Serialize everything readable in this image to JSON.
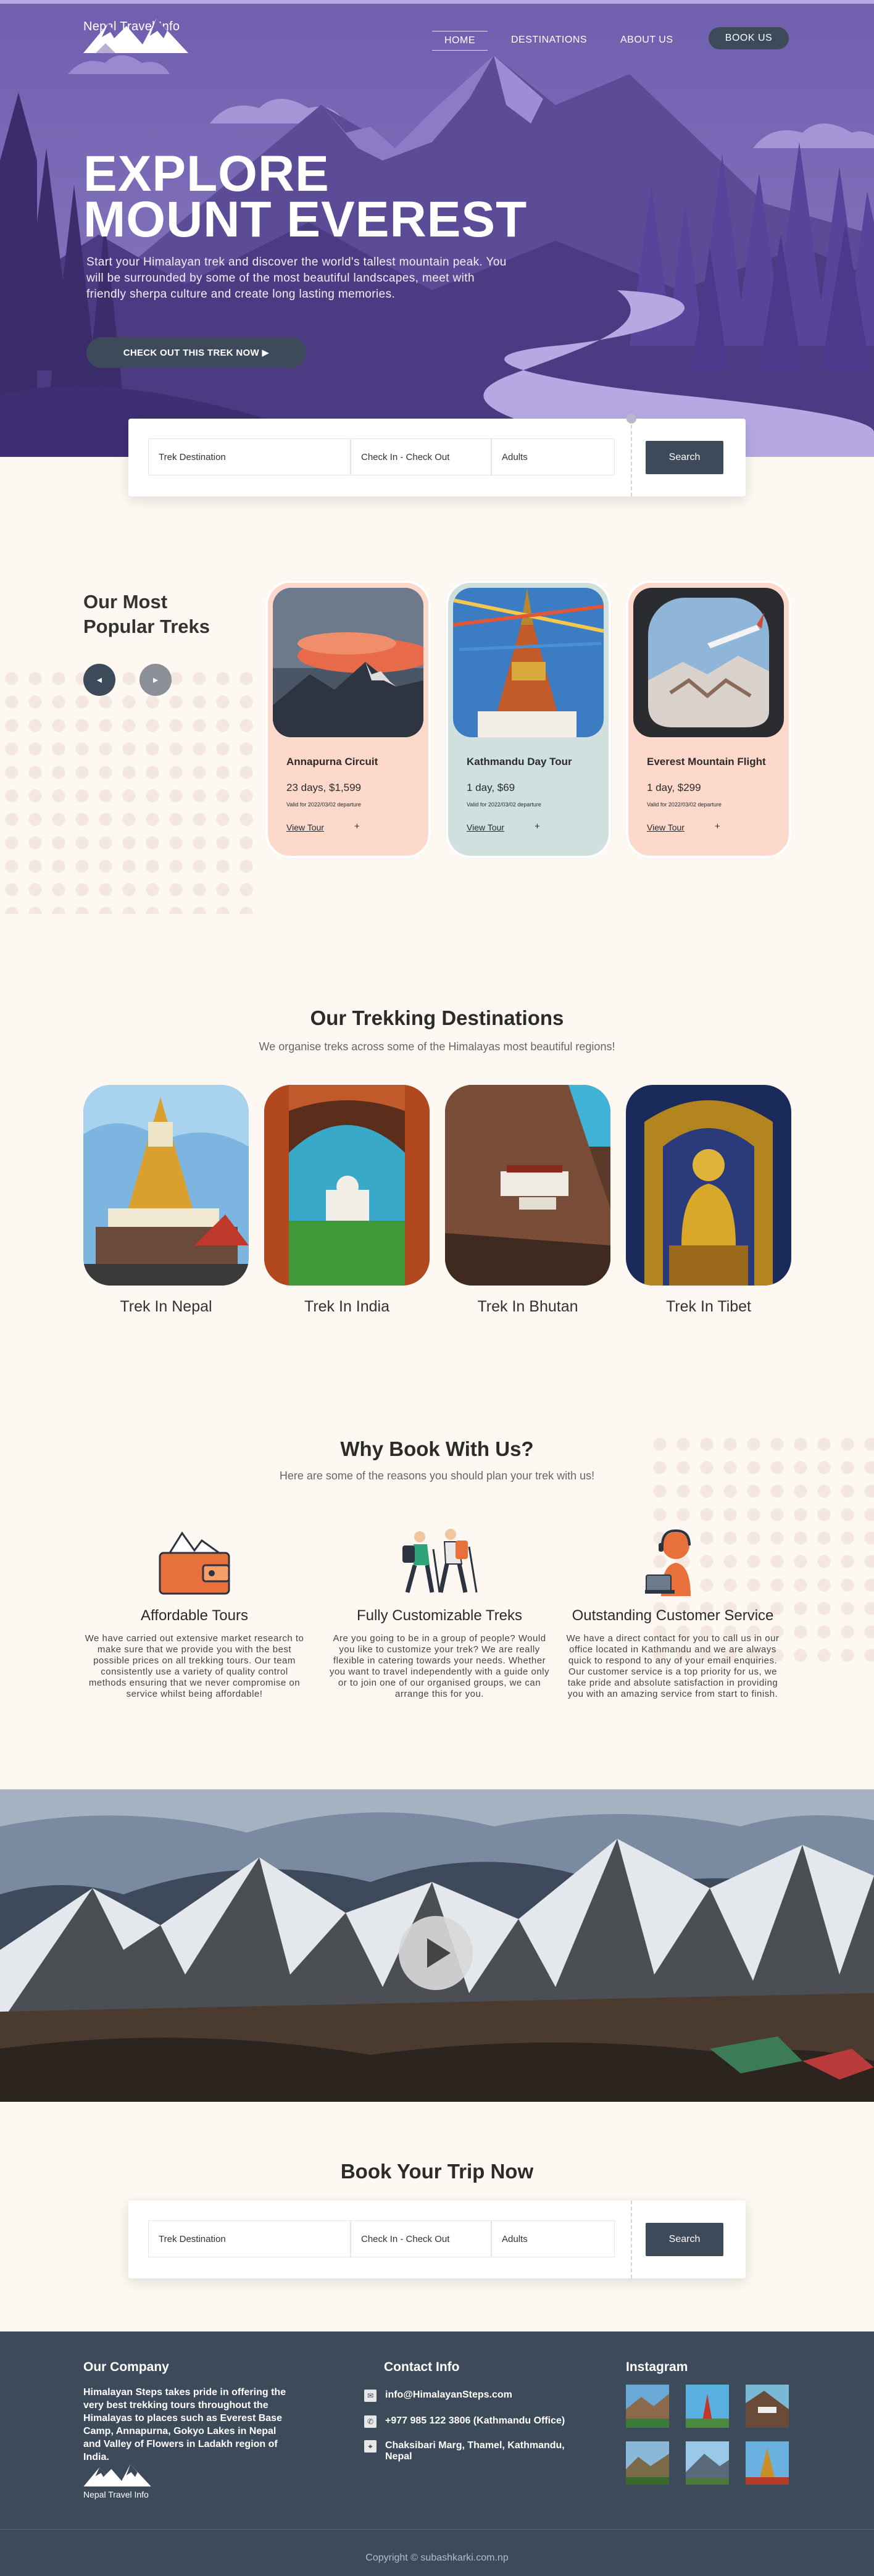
{
  "brand": {
    "name": "Nepal Travel Info"
  },
  "nav": {
    "home": "HOME",
    "destinations": "DESTINATIONS",
    "about": "ABOUT US",
    "book": "BOOK US"
  },
  "hero": {
    "title_line1": "EXPLORE",
    "title_line2": "MOUNT EVEREST",
    "description": "Start your Himalayan trek and discover the world's tallest mountain peak. You will be surrounded by some of the most beautiful landscapes, meet with  friendly sherpa culture and create long lasting memories.",
    "cta": "CHECK OUT THIS TREK NOW ▶"
  },
  "search": {
    "destination": "Trek Destination",
    "dates": "Check In - Check Out",
    "guests": "Adults",
    "button": "Search"
  },
  "popular": {
    "title_line1": "Our Most",
    "title_line2": "Popular Treks",
    "prev": "◂",
    "next": "▸",
    "cards": [
      {
        "title": "Annapurna Circuit",
        "price": "23 days, $1,599",
        "valid": "Valid for 2022/03/02 departure",
        "link": "View Tour",
        "plus": "+"
      },
      {
        "title": "Kathmandu Day Tour",
        "price": "1 day, $69",
        "valid": "Valid for 2022/03/02 departure",
        "link": "View Tour",
        "plus": "+"
      },
      {
        "title": "Everest Mountain Flight",
        "price": "1 day, $299",
        "valid": "Valid for 2022/03/02 departure",
        "link": "View Tour",
        "plus": "+"
      }
    ]
  },
  "destinations": {
    "title": "Our Trekking Destinations",
    "subtitle": "We organise treks across some of the Himalayas most beautiful regions!",
    "items": [
      {
        "label": "Trek In Nepal"
      },
      {
        "label": "Trek In India"
      },
      {
        "label": "Trek In Bhutan"
      },
      {
        "label": "Trek In Tibet"
      }
    ]
  },
  "why": {
    "title": "Why Book With Us?",
    "subtitle": "Here are some of the reasons you should plan your trek with us!",
    "items": [
      {
        "title": "Affordable Tours",
        "text": "We have carried out extensive market research to make sure that we provide you with the best possible prices on all trekking tours. Our team consistently use a variety of quality control methods ensuring that we never compromise on service whilst being affordable!"
      },
      {
        "title": "Fully Customizable Treks",
        "text": "Are you going to be in a group of people? Would you like to customize your trek? We are really flexible in catering towards your needs. Whether you want to travel independently with a guide only or to join one of our organised groups, we can arrange this for you."
      },
      {
        "title": "Outstanding Customer Service",
        "text": "We have a direct contact for you to call us in our office located in Kathmandu and we are always quick to respond to any of your email enquiries. Our customer service is a top priority for us, we take pride and absolute satisfaction in providing you with an amazing service from start to finish."
      }
    ]
  },
  "booking": {
    "title": "Book Your Trip Now"
  },
  "footer": {
    "company_title": "Our Company",
    "company_text": "Himalayan Steps takes pride in offering the very best trekking tours throughout the Himalayas to places such as Everest Base Camp, Annapurna, Gokyo Lakes in Nepal and Valley of Flowers in Ladakh region of India.",
    "contact_title": "Contact Info",
    "email": "info@HimalayanSteps.com",
    "phone": "+977 985 122 3806 (Kathmandu Office)",
    "address": "Chaksibari Marg, Thamel, Kathmandu, Nepal",
    "instagram_title": "Instagram",
    "copyright": "Copyright © subashkarki.com.np"
  },
  "colors": {
    "accent": "#3d4a5a",
    "hero_purple": "#7b6bb3",
    "card_peach": "#fcd9ca",
    "card_teal": "#cfe0de",
    "background": "#fdf8f2",
    "orange": "#e8703a"
  },
  "icons": [
    "logo-mountains-icon",
    "play-icon",
    "wallet-icon",
    "hikers-icon",
    "support-agent-icon",
    "email-icon",
    "phone-icon",
    "location-icon"
  ]
}
